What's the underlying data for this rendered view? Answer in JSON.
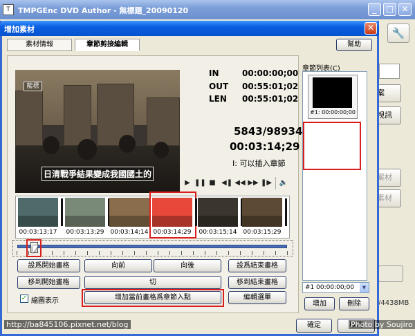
{
  "app": {
    "title": "TMPGEnc DVD Author - 無標題_20090120",
    "icon_text": "T",
    "minimize": "_",
    "maximize": "□",
    "close": "✕",
    "right_buttons": [
      "案",
      "視訊",
      "案材",
      "素材"
    ],
    "size_label": "/4438MB"
  },
  "dialog": {
    "title": "增加素材",
    "close_label": "✕",
    "tabs": [
      "素材情報",
      "章節剪接編輯"
    ],
    "help_label": "幫助"
  },
  "timecode": {
    "in_label": "IN",
    "in_value": "00:00:00;00",
    "out_label": "OUT",
    "out_value": "00:55:01;02",
    "len_label": "LEN",
    "len_value": "00:55:01;02",
    "frame_count": "5843/98934",
    "current_time": "00:03:14;29",
    "insert_hint": "I: 可以插入章節"
  },
  "video": {
    "badge": "龍標",
    "caption": "日清戰爭結果變成我國國土的"
  },
  "playback_controls": [
    "▶",
    "❚❚",
    "■",
    "◀❚",
    "◀◀",
    "▶▶",
    "❚▶",
    "🔈"
  ],
  "filmstrip": {
    "times": [
      "00:03:13;17",
      "00:03:13;29",
      "00:03:14;14",
      "00:03:14;29",
      "00:03:15;14",
      "00:03:15;29"
    ],
    "colors": [
      "#4f6a6a",
      "#7a8a78",
      "#8a6d4c",
      "#e8483a",
      "#3a352d",
      "#5c4a34"
    ]
  },
  "buttons": {
    "set_start": "設爲開始畫格",
    "prev": "向前",
    "next": "向後",
    "set_end": "設爲結束畫格",
    "goto_start": "移到開始畫格",
    "cut": "切",
    "goto_end": "移到結束畫格",
    "add_chapter": "增加當前畫格爲章節入點",
    "edit_menu": "編輯選單",
    "add": "增加",
    "delete": "刪除",
    "ok": "確定",
    "cancel": "取消"
  },
  "checkbox": {
    "label": "縮圖表示",
    "checked": true,
    "mark": "✓"
  },
  "chapter_list": {
    "label": "章節列表(C)",
    "items": [
      {
        "time": "#1: 00:00:00;00"
      }
    ],
    "selected": "#1   00:00:00;00",
    "dropdown_arrow": "▼"
  },
  "watermarks": {
    "left": "http://ba845106.pixnet.net/blog",
    "right": "Photo by Soujiro"
  }
}
